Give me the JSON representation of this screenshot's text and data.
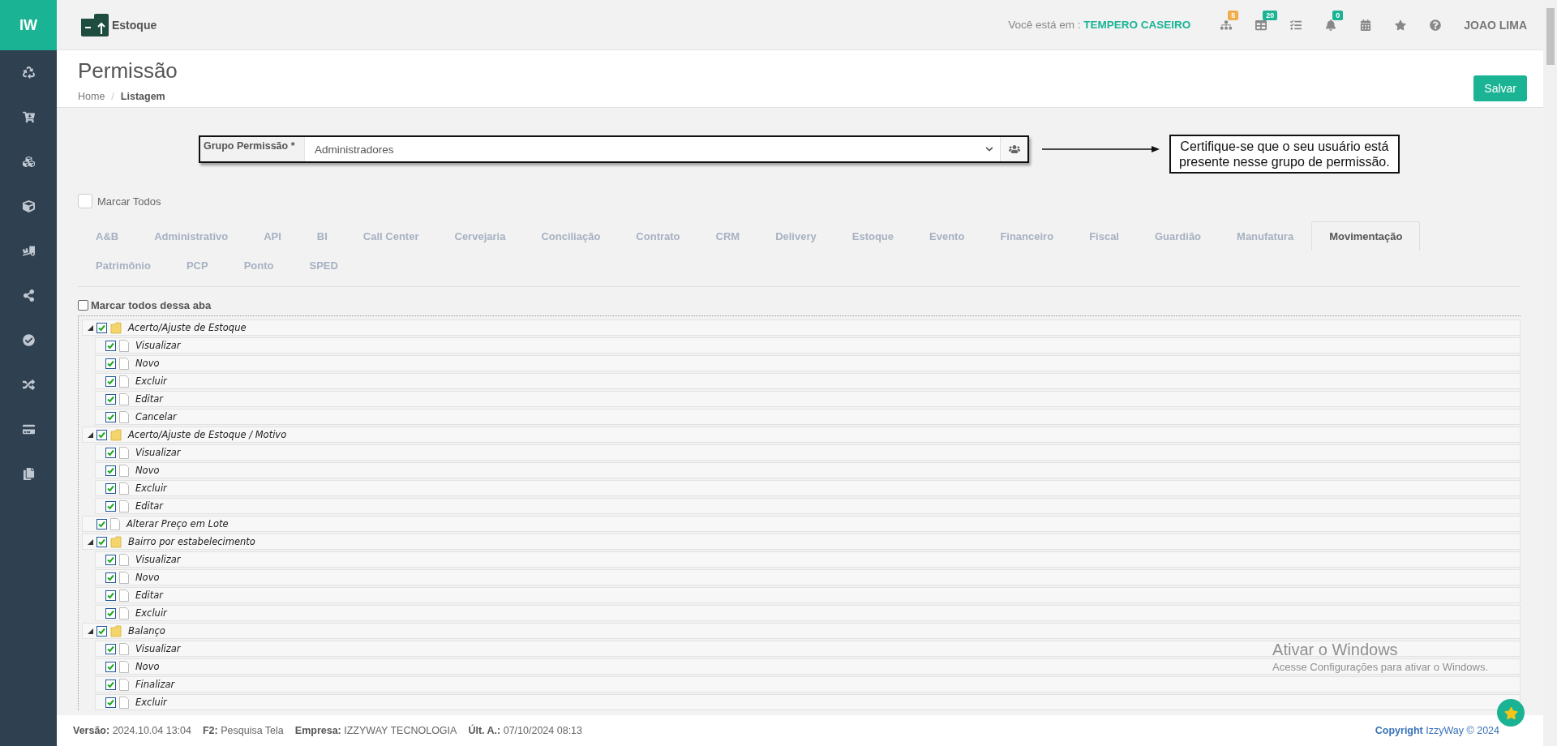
{
  "sidebar": {
    "logo": "IW"
  },
  "header": {
    "module": "Estoque",
    "location_label": "Você está em :",
    "location": "TEMPERO CASEIRO",
    "user": "JOAO LIMA",
    "tools": [
      {
        "kind": "sitemap",
        "badge": "5",
        "color": "#f0ad4e"
      },
      {
        "kind": "table",
        "badge": "20",
        "color": "#1ab394"
      },
      {
        "kind": "tasks"
      },
      {
        "kind": "bell",
        "badge": "0",
        "color": "#1ab394"
      },
      {
        "kind": "calendar"
      },
      {
        "kind": "star"
      },
      {
        "kind": "help"
      }
    ]
  },
  "page": {
    "title": "Permissão",
    "breadcrumb": [
      "Home",
      "Listagem"
    ],
    "breadcrumb_separator": "/",
    "save_button": "Salvar"
  },
  "group_field": {
    "label": "Grupo Permissão *",
    "value": "Administradores"
  },
  "callout": {
    "lines": [
      "Certifique-se que o seu usuário está",
      "presente nesse grupo de permissão."
    ]
  },
  "mark_all": {
    "label": "Marcar Todos",
    "checked": false
  },
  "tab_rows": [
    [
      {
        "label": "A&B",
        "selected": false
      },
      {
        "label": "Administrativo",
        "selected": false
      },
      {
        "label": "API",
        "selected": false
      },
      {
        "label": "BI",
        "selected": false
      },
      {
        "label": "Call Center",
        "selected": false
      },
      {
        "label": "Cervejaria",
        "selected": false
      },
      {
        "label": "Conciliação",
        "selected": false
      },
      {
        "label": "Contrato",
        "selected": false
      },
      {
        "label": "CRM",
        "selected": false
      },
      {
        "label": "Delivery",
        "selected": false
      },
      {
        "label": "Estoque",
        "selected": false
      },
      {
        "label": "Evento",
        "selected": false
      },
      {
        "label": "Financeiro",
        "selected": false
      },
      {
        "label": "Fiscal",
        "selected": false
      },
      {
        "label": "Guardião",
        "selected": false
      },
      {
        "label": "Manufatura",
        "selected": false
      },
      {
        "label": "Movimentação",
        "selected": true
      }
    ],
    [
      {
        "label": "Patrimônio",
        "selected": false
      },
      {
        "label": "PCP",
        "selected": false
      },
      {
        "label": "Ponto",
        "selected": false
      },
      {
        "label": "SPED",
        "selected": false
      }
    ]
  ],
  "mark_tab": {
    "label": "Marcar todos dessa aba",
    "checked": false
  },
  "tree": [
    {
      "label": "Acerto/Ajuste de Estoque",
      "checked": true,
      "expanded": true,
      "children": [
        {
          "label": "Visualizar",
          "checked": true
        },
        {
          "label": "Novo",
          "checked": true
        },
        {
          "label": "Excluir",
          "checked": true
        },
        {
          "label": "Editar",
          "checked": true
        },
        {
          "label": "Cancelar",
          "checked": true
        }
      ]
    },
    {
      "label": "Acerto/Ajuste de Estoque / Motivo",
      "checked": true,
      "expanded": true,
      "children": [
        {
          "label": "Visualizar",
          "checked": true
        },
        {
          "label": "Novo",
          "checked": true
        },
        {
          "label": "Excluir",
          "checked": true
        },
        {
          "label": "Editar",
          "checked": true
        }
      ]
    },
    {
      "label": "Alterar Preço em Lote",
      "checked": true
    },
    {
      "label": "Bairro por estabelecimento",
      "checked": true,
      "expanded": true,
      "children": [
        {
          "label": "Visualizar",
          "checked": true
        },
        {
          "label": "Novo",
          "checked": true
        },
        {
          "label": "Editar",
          "checked": true
        },
        {
          "label": "Excluir",
          "checked": true
        }
      ]
    },
    {
      "label": "Balanço",
      "checked": true,
      "expanded": true,
      "children": [
        {
          "label": "Visualizar",
          "checked": true
        },
        {
          "label": "Novo",
          "checked": true
        },
        {
          "label": "Finalizar",
          "checked": true
        },
        {
          "label": "Excluir",
          "checked": true
        }
      ]
    }
  ],
  "footer": {
    "items": [
      "**Versão:** 2024.10.04 13:04",
      "**F2:** Pesquisa Tela",
      "**Empresa:** IZZYWAY TECNOLOGIA",
      "**Últ. A.:** 07/10/2024 08:13"
    ],
    "copyright": "**Copyright** IzzyWay © 2024"
  },
  "os_notice": {
    "title": "Ativar o Windows",
    "text": "Acesse Configurações para ativar o Windows."
  }
}
